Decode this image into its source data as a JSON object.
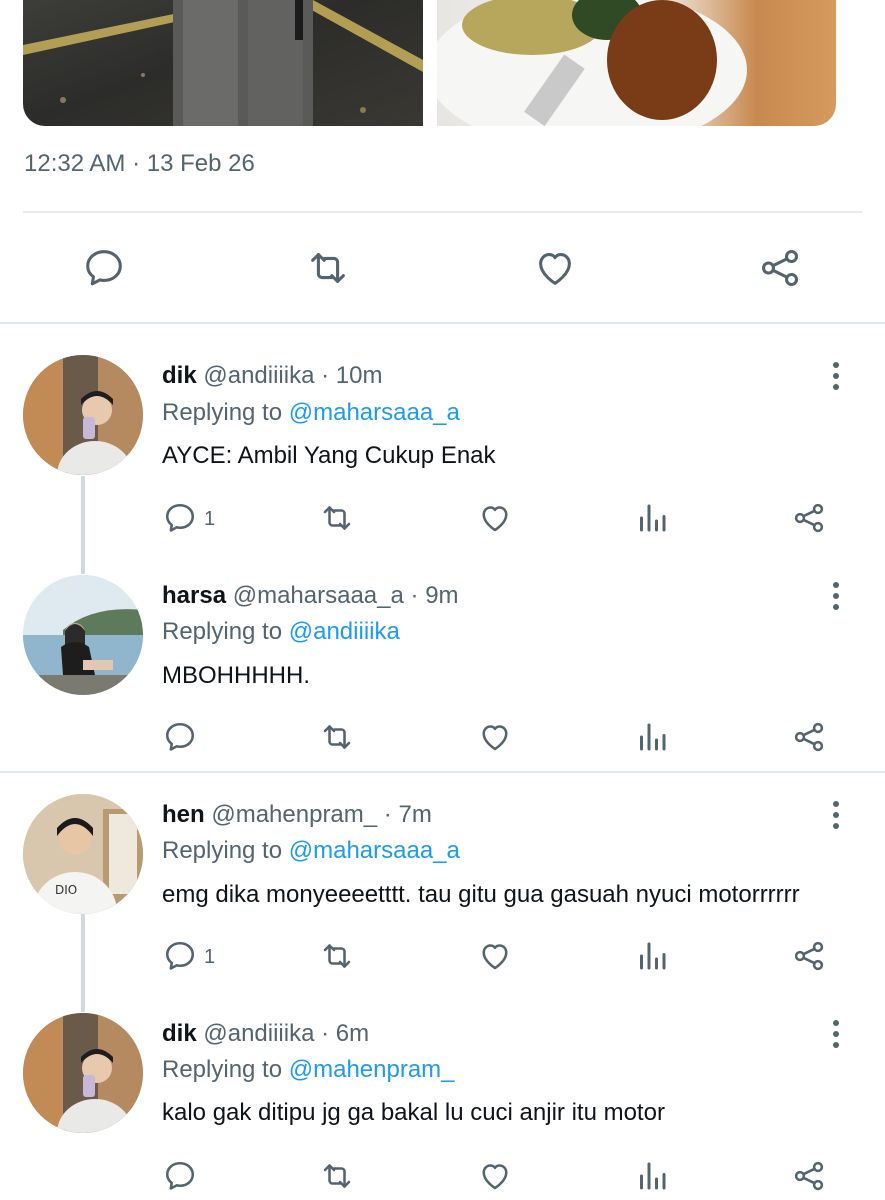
{
  "main_tweet": {
    "timestamp": "12:32 AM · 13 Feb 26",
    "photos": [
      "photo-person-night-street",
      "photo-rice-plate-food"
    ],
    "actions": [
      "comment-icon",
      "retweet-icon",
      "like-icon",
      "share-icon"
    ]
  },
  "replies": [
    {
      "name": "dik",
      "handle": "@andiiiika",
      "time": "10m",
      "replying_label": "Replying to",
      "replying_to": "@maharsaaa_a",
      "text": "AYCE: Ambil Yang Cukup Enak",
      "reply_count": "1"
    },
    {
      "name": "harsa",
      "handle": "@maharsaaa_a",
      "time": "9m",
      "replying_label": "Replying to",
      "replying_to": "@andiiiika",
      "text": "MBOHHHHH.",
      "reply_count": ""
    },
    {
      "name": "hen",
      "handle": "@mahenpram_",
      "time": "7m",
      "replying_label": "Replying to",
      "replying_to": "@maharsaaa_a",
      "text": "emg dika monyeeeetttt. tau gitu gua gasuah nyuci motorrrrrr",
      "reply_count": "1"
    },
    {
      "name": "dik",
      "handle": "@andiiiika",
      "time": "6m",
      "replying_label": "Replying to",
      "replying_to": "@mahenpram_",
      "text": "kalo gak ditipu jg ga bakal lu cuci anjir itu motor",
      "reply_count": ""
    }
  ],
  "colors": {
    "accent": "#1d9bf0",
    "secondary_text": "#536471",
    "primary_text": "#0f1419"
  }
}
